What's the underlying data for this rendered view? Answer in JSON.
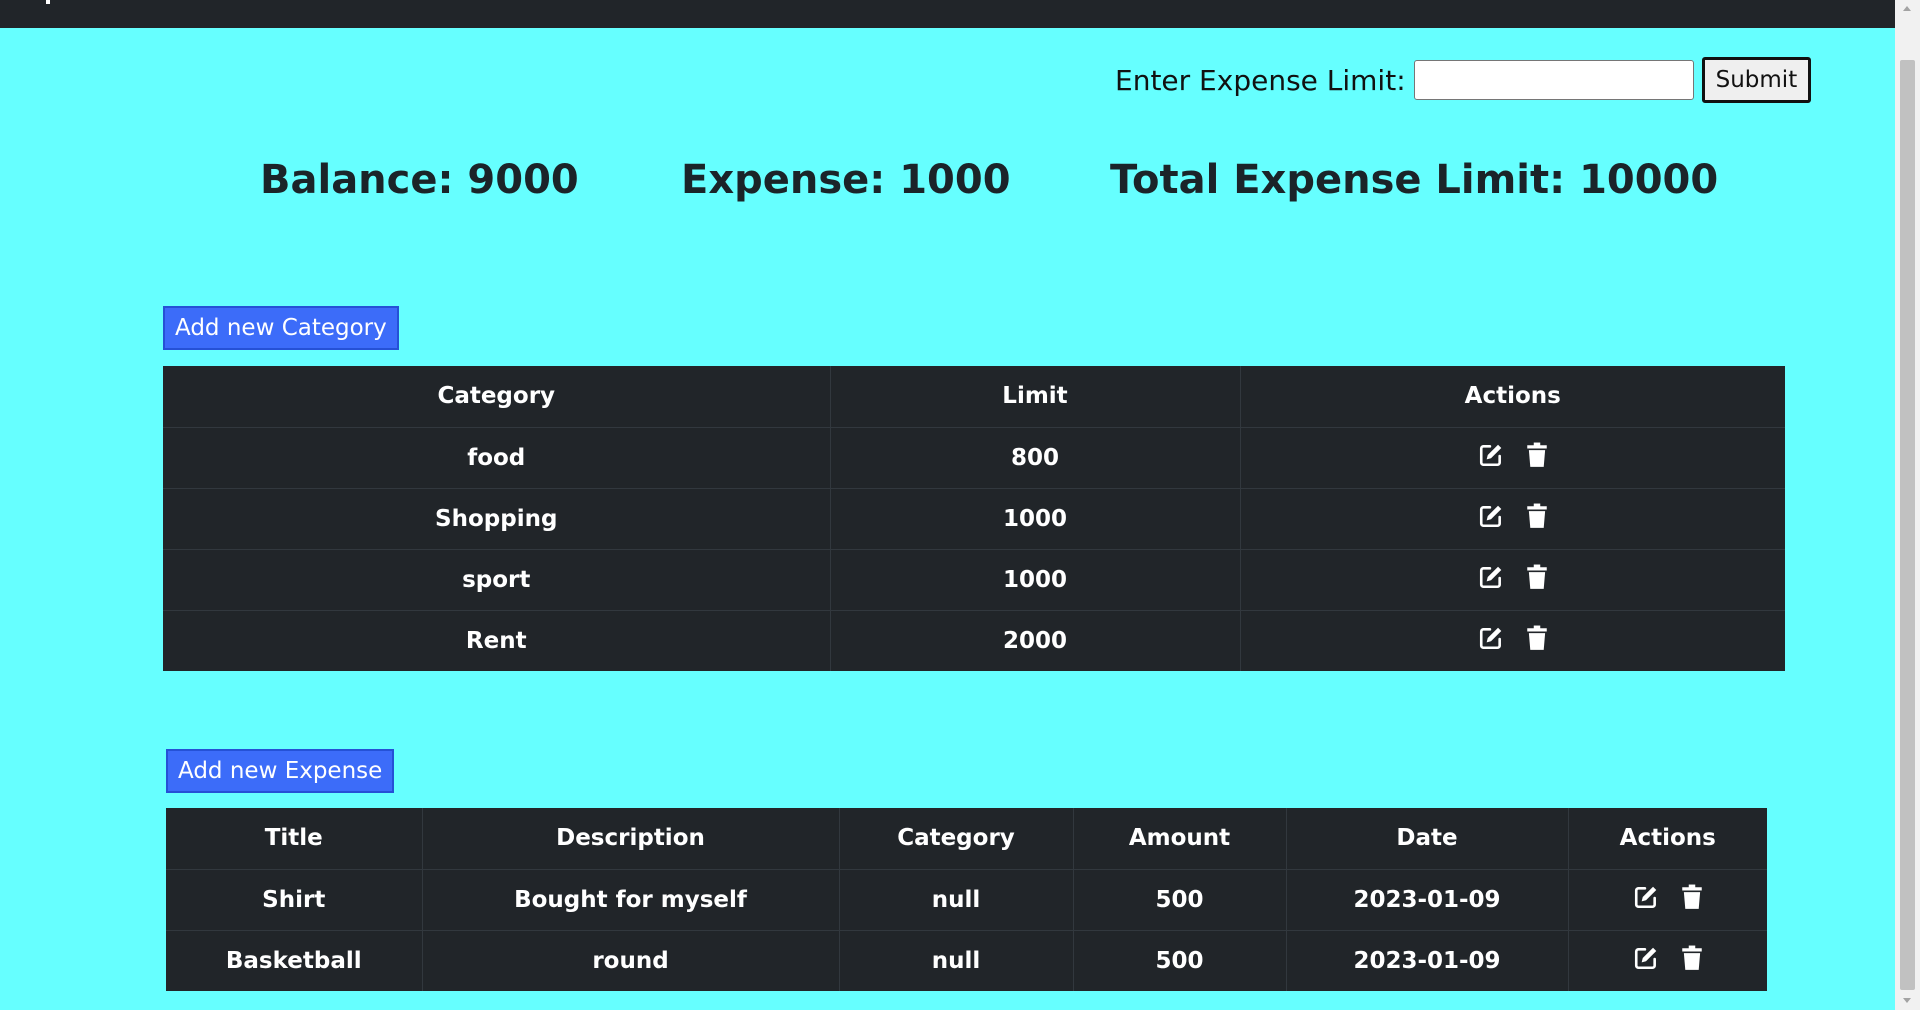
{
  "limit_form": {
    "label": "Enter Expense Limit:",
    "input_value": "",
    "input_placeholder": "",
    "submit_label": "Submit"
  },
  "stats": {
    "balance": "Balance: 9000",
    "expense": "Expense: 1000",
    "total_limit": "Total Expense Limit: 10000"
  },
  "categories": {
    "add_label": "Add new Category",
    "headers": [
      "Category",
      "Limit",
      "Actions"
    ],
    "rows": [
      {
        "category": "food",
        "limit": "800"
      },
      {
        "category": "Shopping",
        "limit": "1000"
      },
      {
        "category": "sport",
        "limit": "1000"
      },
      {
        "category": "Rent",
        "limit": "2000"
      }
    ]
  },
  "expenses": {
    "add_label": "Add new Expense",
    "headers": [
      "Title",
      "Description",
      "Category",
      "Amount",
      "Date",
      "Actions"
    ],
    "rows": [
      {
        "title": "Shirt",
        "description": "Bought for myself",
        "category": "null",
        "amount": "500",
        "date": "2023-01-09"
      },
      {
        "title": "Basketball",
        "description": "round",
        "category": "null",
        "amount": "500",
        "date": "2023-01-09"
      }
    ]
  },
  "icons": {
    "edit": "edit-icon",
    "delete": "trash-icon"
  },
  "colors": {
    "page_background": "#66ffff",
    "table_background": "#212529",
    "button_primary": "#3c6cf9",
    "topbar": "#212529"
  }
}
